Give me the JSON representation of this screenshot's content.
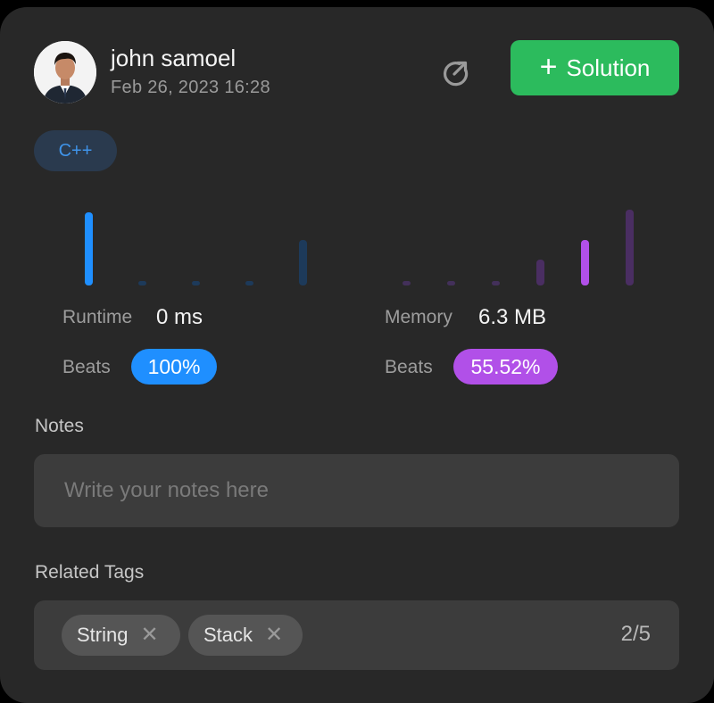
{
  "user": {
    "name": "john samoel",
    "timestamp": "Feb 26, 2023 16:28"
  },
  "header": {
    "share_icon": "share-arrow-icon",
    "solution_label": "Solution",
    "solution_icon": "plus-icon"
  },
  "language": {
    "label": "C++"
  },
  "runtime": {
    "label": "Runtime",
    "value": "0 ms",
    "beats_label": "Beats",
    "beats_value": "100%",
    "color": "#1f8fff"
  },
  "memory": {
    "label": "Memory",
    "value": "6.3 MB",
    "beats_label": "Beats",
    "beats_value": "55.52%",
    "color": "#b150e8"
  },
  "notes": {
    "label": "Notes",
    "placeholder": "Write your notes here"
  },
  "tags": {
    "label": "Related Tags",
    "items": [
      "String",
      "Stack"
    ],
    "count": "2/5",
    "remove_icon": "close-icon"
  },
  "colors": {
    "accent_green": "#2cbb5d",
    "background": "#282828"
  }
}
